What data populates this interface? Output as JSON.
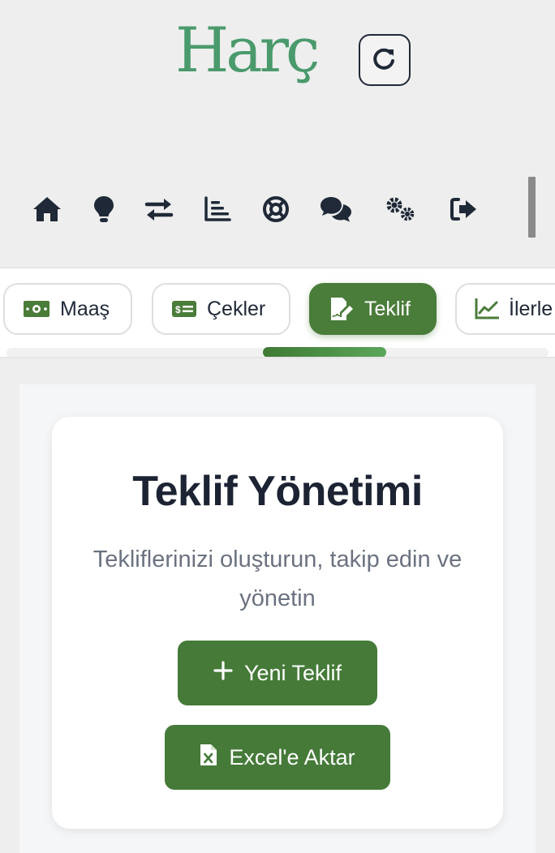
{
  "header": {
    "logo_text": "Harç",
    "refresh_icon": "refresh-icon"
  },
  "icon_nav": [
    {
      "name": "home-icon"
    },
    {
      "name": "lightbulb-icon"
    },
    {
      "name": "exchange-icon"
    },
    {
      "name": "chart-bars-icon"
    },
    {
      "name": "lifebuoy-icon"
    },
    {
      "name": "chat-bubbles-icon"
    },
    {
      "name": "gears-icon"
    },
    {
      "name": "logout-icon"
    }
  ],
  "tabs": [
    {
      "label": "Maaş",
      "icon": "money-bill-icon",
      "active": false
    },
    {
      "label": "Çekler",
      "icon": "check-bill-icon",
      "active": false
    },
    {
      "label": "Teklif",
      "icon": "file-signature-icon",
      "active": true
    },
    {
      "label": "İlerle",
      "icon": "line-chart-icon",
      "active": false
    }
  ],
  "main": {
    "title": "Teklif Yönetimi",
    "subtitle": "Tekliflerinizi oluşturun, takip edin ve yönetin",
    "new_button_label": "Yeni Teklif",
    "export_button_label": "Excel'e Aktar"
  },
  "colors": {
    "brand_green": "#4a7c3a",
    "logo_green": "#4a9a6c",
    "dark_text": "#1c2333",
    "muted_text": "#6b7280"
  }
}
